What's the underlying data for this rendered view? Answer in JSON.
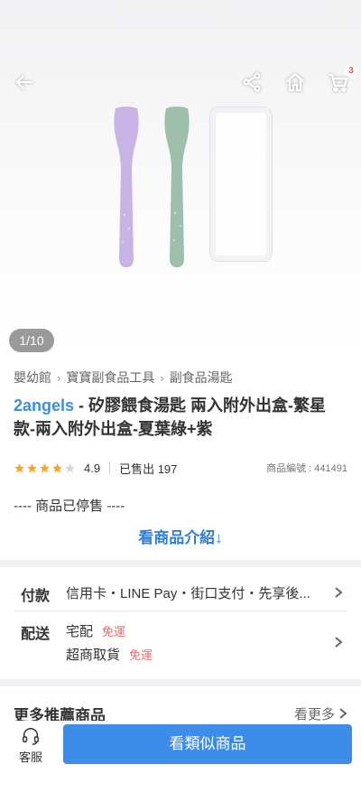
{
  "gallery": {
    "counter": "1/10",
    "cart_count": "3"
  },
  "breadcrumb": [
    "嬰幼館",
    "寶寶副食品工具",
    "副食品湯匙"
  ],
  "product": {
    "brand": "2angels",
    "title_rest": " - 矽膠餵食湯匙 兩入附外出盒-繁星款-兩入附外出盒-夏葉綠+紫",
    "rating": "4.9",
    "sold": "已售出 197",
    "product_id": "商品編號 : 441491",
    "status": "---- 商品已停售 ----",
    "intro_link": "看商品介紹↓"
  },
  "payment": {
    "label": "付款",
    "text": "信用卡・LINE Pay・街口支付・先享後..."
  },
  "delivery": {
    "label": "配送",
    "options": [
      {
        "name": "宅配",
        "fee": "免運"
      },
      {
        "name": "超商取貨",
        "fee": "免運"
      }
    ]
  },
  "recommend": {
    "title": "更多推薦商品",
    "more": "看更多"
  },
  "bottom": {
    "service": "客服",
    "cta": "看類似商品"
  },
  "colors": {
    "accent": "#3d8ce8",
    "brand": "#3a8fdf",
    "free": "#e26b6b",
    "star": "#f5a623"
  }
}
